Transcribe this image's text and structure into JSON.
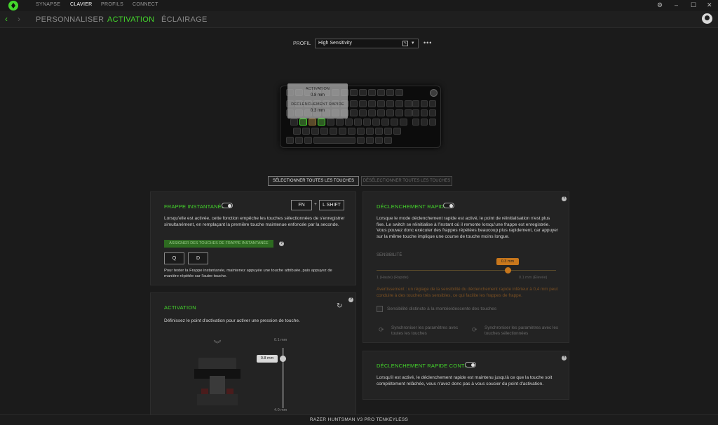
{
  "app": {
    "top_tabs": [
      "SYNAPSE",
      "CLAVIER",
      "PROFILS",
      "CONNECT"
    ],
    "window_controls": {
      "settings": "⚙",
      "minimize": "–",
      "maximize": "☐",
      "close": "✕"
    }
  },
  "subnav": {
    "back": "‹",
    "forward": "›",
    "tabs": [
      "PERSONNALISER",
      "ACTIVATION",
      "ÉCLAIRAGE"
    ]
  },
  "profile": {
    "label": "PROFIL",
    "value": "High Sensitivity",
    "more": "•••"
  },
  "keyboard_tip": {
    "activation_label": "ACTIVATION",
    "activation_value": "0.8 mm",
    "rapid_label": "DÉCLENCHEMENT RAPIDE",
    "rapid_value": "0.3 mm"
  },
  "selection": {
    "select_all": "SÉLECTIONNER TOUTES LES TOUCHES",
    "deselect_all": "DÉSÉLECTIONNER TOUTES LES TOUCHES"
  },
  "snap_tap": {
    "title": "FRAPPE INSTANTANÉE",
    "key1": "FN",
    "plus": "+",
    "key2": "L SHIFT",
    "description": "Lorsqu'elle est activée, cette fonction empêche les touches sélectionnées de s'enregistrer simultanément, en remplaçant la première touche maintenue enfoncée par la seconde.",
    "assign_button": "ASSIGNER DES TOUCHES DE FRAPPE INSTANTANÉE",
    "assigned_key1": "Q",
    "assigned_key2": "D",
    "hint": "Pour tester la Frappe instantanée, maintenez appuyée une touche attribuée, puis appuyez de manière répétée sur l'autre touche."
  },
  "activation": {
    "title": "ACTIVATION",
    "description": "Définissez le point d'activation pour activer une pression de touche.",
    "slider_top": "0.1 mm",
    "slider_value": "0.8 mm",
    "slider_bottom": "4.0 mm",
    "slider_fraction": 0.18
  },
  "rapid_trigger": {
    "title": "DÉCLENCHEMENT RAPIDE",
    "description": "Lorsque le mode déclenchement rapide est activé, le point de réinitialisation n'est plus fixe. Le switch se réinitialise à l'instant où il remonte lorsqu'une frappe est enregistrée. Vous pouvez donc exécuter des frappes répétées beaucoup plus rapidement, car appuyer sur la même touche implique une course de touche moins longue.",
    "sensitivity_label": "SENSIBILITÉ",
    "sensitivity_value": "0.3 mm",
    "sensitivity_fraction": 0.73,
    "slider_left": "1 (Haute) (Rapide)",
    "slider_right": "0.1 mm (Élevée)",
    "warning": "Avertissement : un réglage de la sensibilité du déclenchement rapide inférieur à 0,4 mm peut conduire à des touches très sensibles, ce qui facilite les frappes de frappe.",
    "checkbox_label": "Sensibilité distincte à la montée/descente des touches",
    "sync_all": "Synchroniser les paramètres avec toutes les touches",
    "sync_selected": "Synchroniser les paramètres avec les touches sélectionnées"
  },
  "continuous_rapid": {
    "title": "DÉCLENCHEMENT RAPIDE CONTINU",
    "description": "Lorsqu'il est activé, le déclenchement rapide est maintenu jusqu'à ce que la touche soit complètement relâchée, vous n'avez donc pas à vous soucier du point d'activation."
  },
  "footer": {
    "device": "RAZER HUNTSMAN V3 PRO TENKEYLESS"
  },
  "colors": {
    "accent": "#44d62c",
    "background": "#1b1b1b",
    "panel": "#232323",
    "warning": "#c8771c"
  }
}
